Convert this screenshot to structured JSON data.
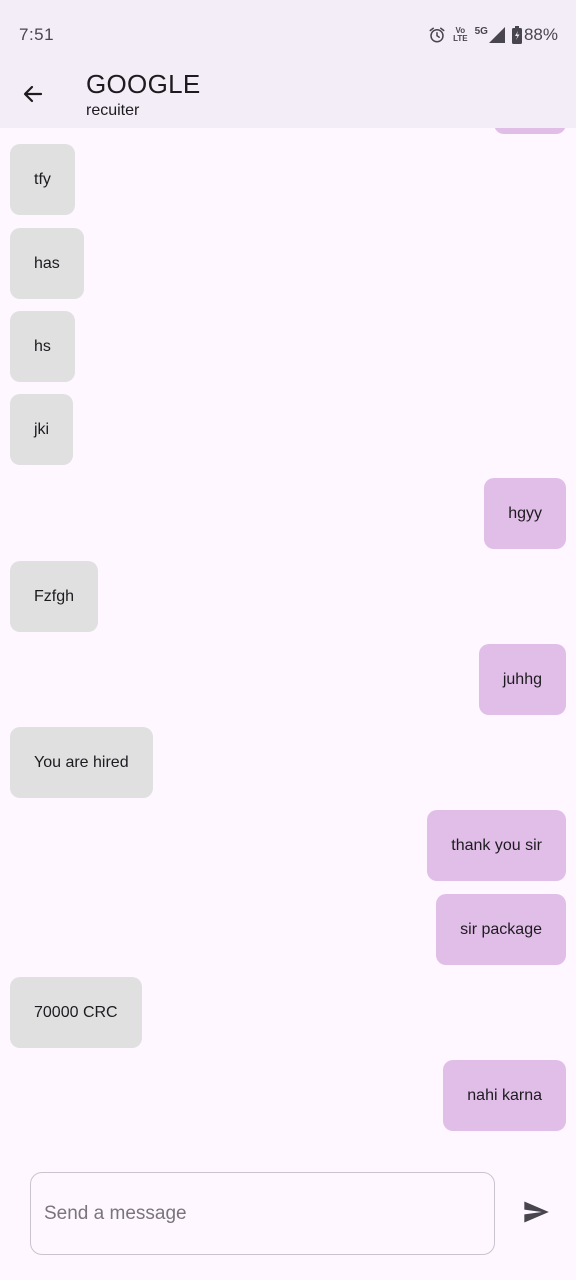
{
  "status_bar": {
    "time": "7:51",
    "network_volte_top": "Vo",
    "network_volte_bottom": "LTE",
    "network_type": "5G",
    "battery": "88%",
    "icons": [
      "alarm-icon",
      "volte-icon",
      "signal-icon",
      "battery-icon"
    ]
  },
  "app_bar": {
    "title": "GOOGLE",
    "subtitle": "recuiter",
    "back_icon": "arrow-left-icon"
  },
  "messages": [
    {
      "text": "tfy",
      "side": "received"
    },
    {
      "text": "has",
      "side": "received"
    },
    {
      "text": "hs",
      "side": "received"
    },
    {
      "text": "jki",
      "side": "received"
    },
    {
      "text": "hgyy",
      "side": "sent"
    },
    {
      "text": "Fzfgh",
      "side": "received"
    },
    {
      "text": "juhhg",
      "side": "sent"
    },
    {
      "text": "You are hired",
      "side": "received"
    },
    {
      "text": "thank you sir",
      "side": "sent"
    },
    {
      "text": "sir package",
      "side": "sent"
    },
    {
      "text": "70000 CRC",
      "side": "received"
    },
    {
      "text": "nahi karna",
      "side": "sent"
    }
  ],
  "composer": {
    "placeholder": "Send a message",
    "value": "",
    "send_icon": "send-icon"
  },
  "colors": {
    "background": "#fef7ff",
    "app_bar": "#f3edf7",
    "received_bubble": "#e0e0e0",
    "sent_bubble": "#e1bee7",
    "text": "#1d1b20"
  }
}
